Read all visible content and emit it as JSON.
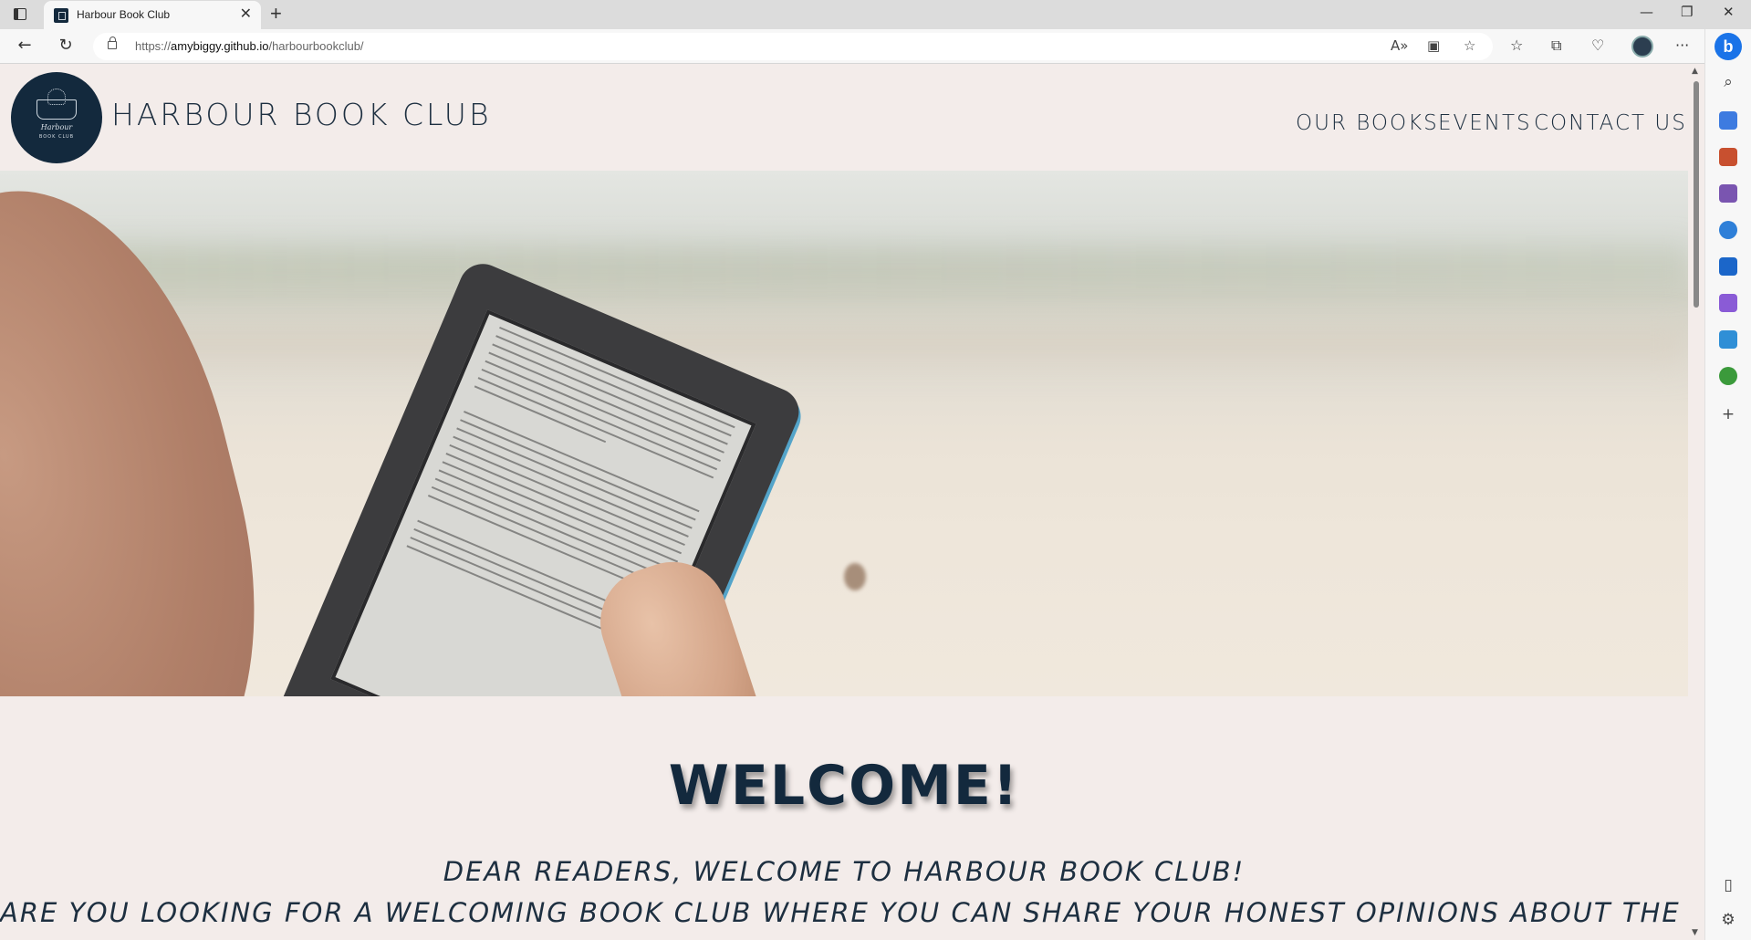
{
  "browser": {
    "tab_title": "Harbour Book Club",
    "tab_close": "✕",
    "new_tab": "+",
    "url_prefix": "https://",
    "url_host": "amybiggy.github.io",
    "url_path": "/harbourbookclub/",
    "window_controls": [
      "—",
      "❐",
      "✕"
    ],
    "more_menu": "···"
  },
  "site": {
    "brand": "HARBOUR BOOK CLUB",
    "logo_script": "Harbour",
    "logo_small": "BOOK CLUB",
    "nav": [
      "OUR BOOKS",
      "EVENTS",
      "CONTACT US"
    ],
    "welcome_heading": "WELCOME!",
    "intro_line_1": "DEAR READERS, WELCOME TO HARBOUR BOOK CLUB!",
    "intro_line_2": "ARE YOU LOOKING FOR A WELCOMING BOOK CLUB WHERE YOU CAN SHARE YOUR HONEST OPINIONS ABOUT THE BOOKS YOU"
  },
  "colors": {
    "page_background": "#f3ecea",
    "brand_navy": "#13293d",
    "text_navy": "#1d2f40"
  }
}
